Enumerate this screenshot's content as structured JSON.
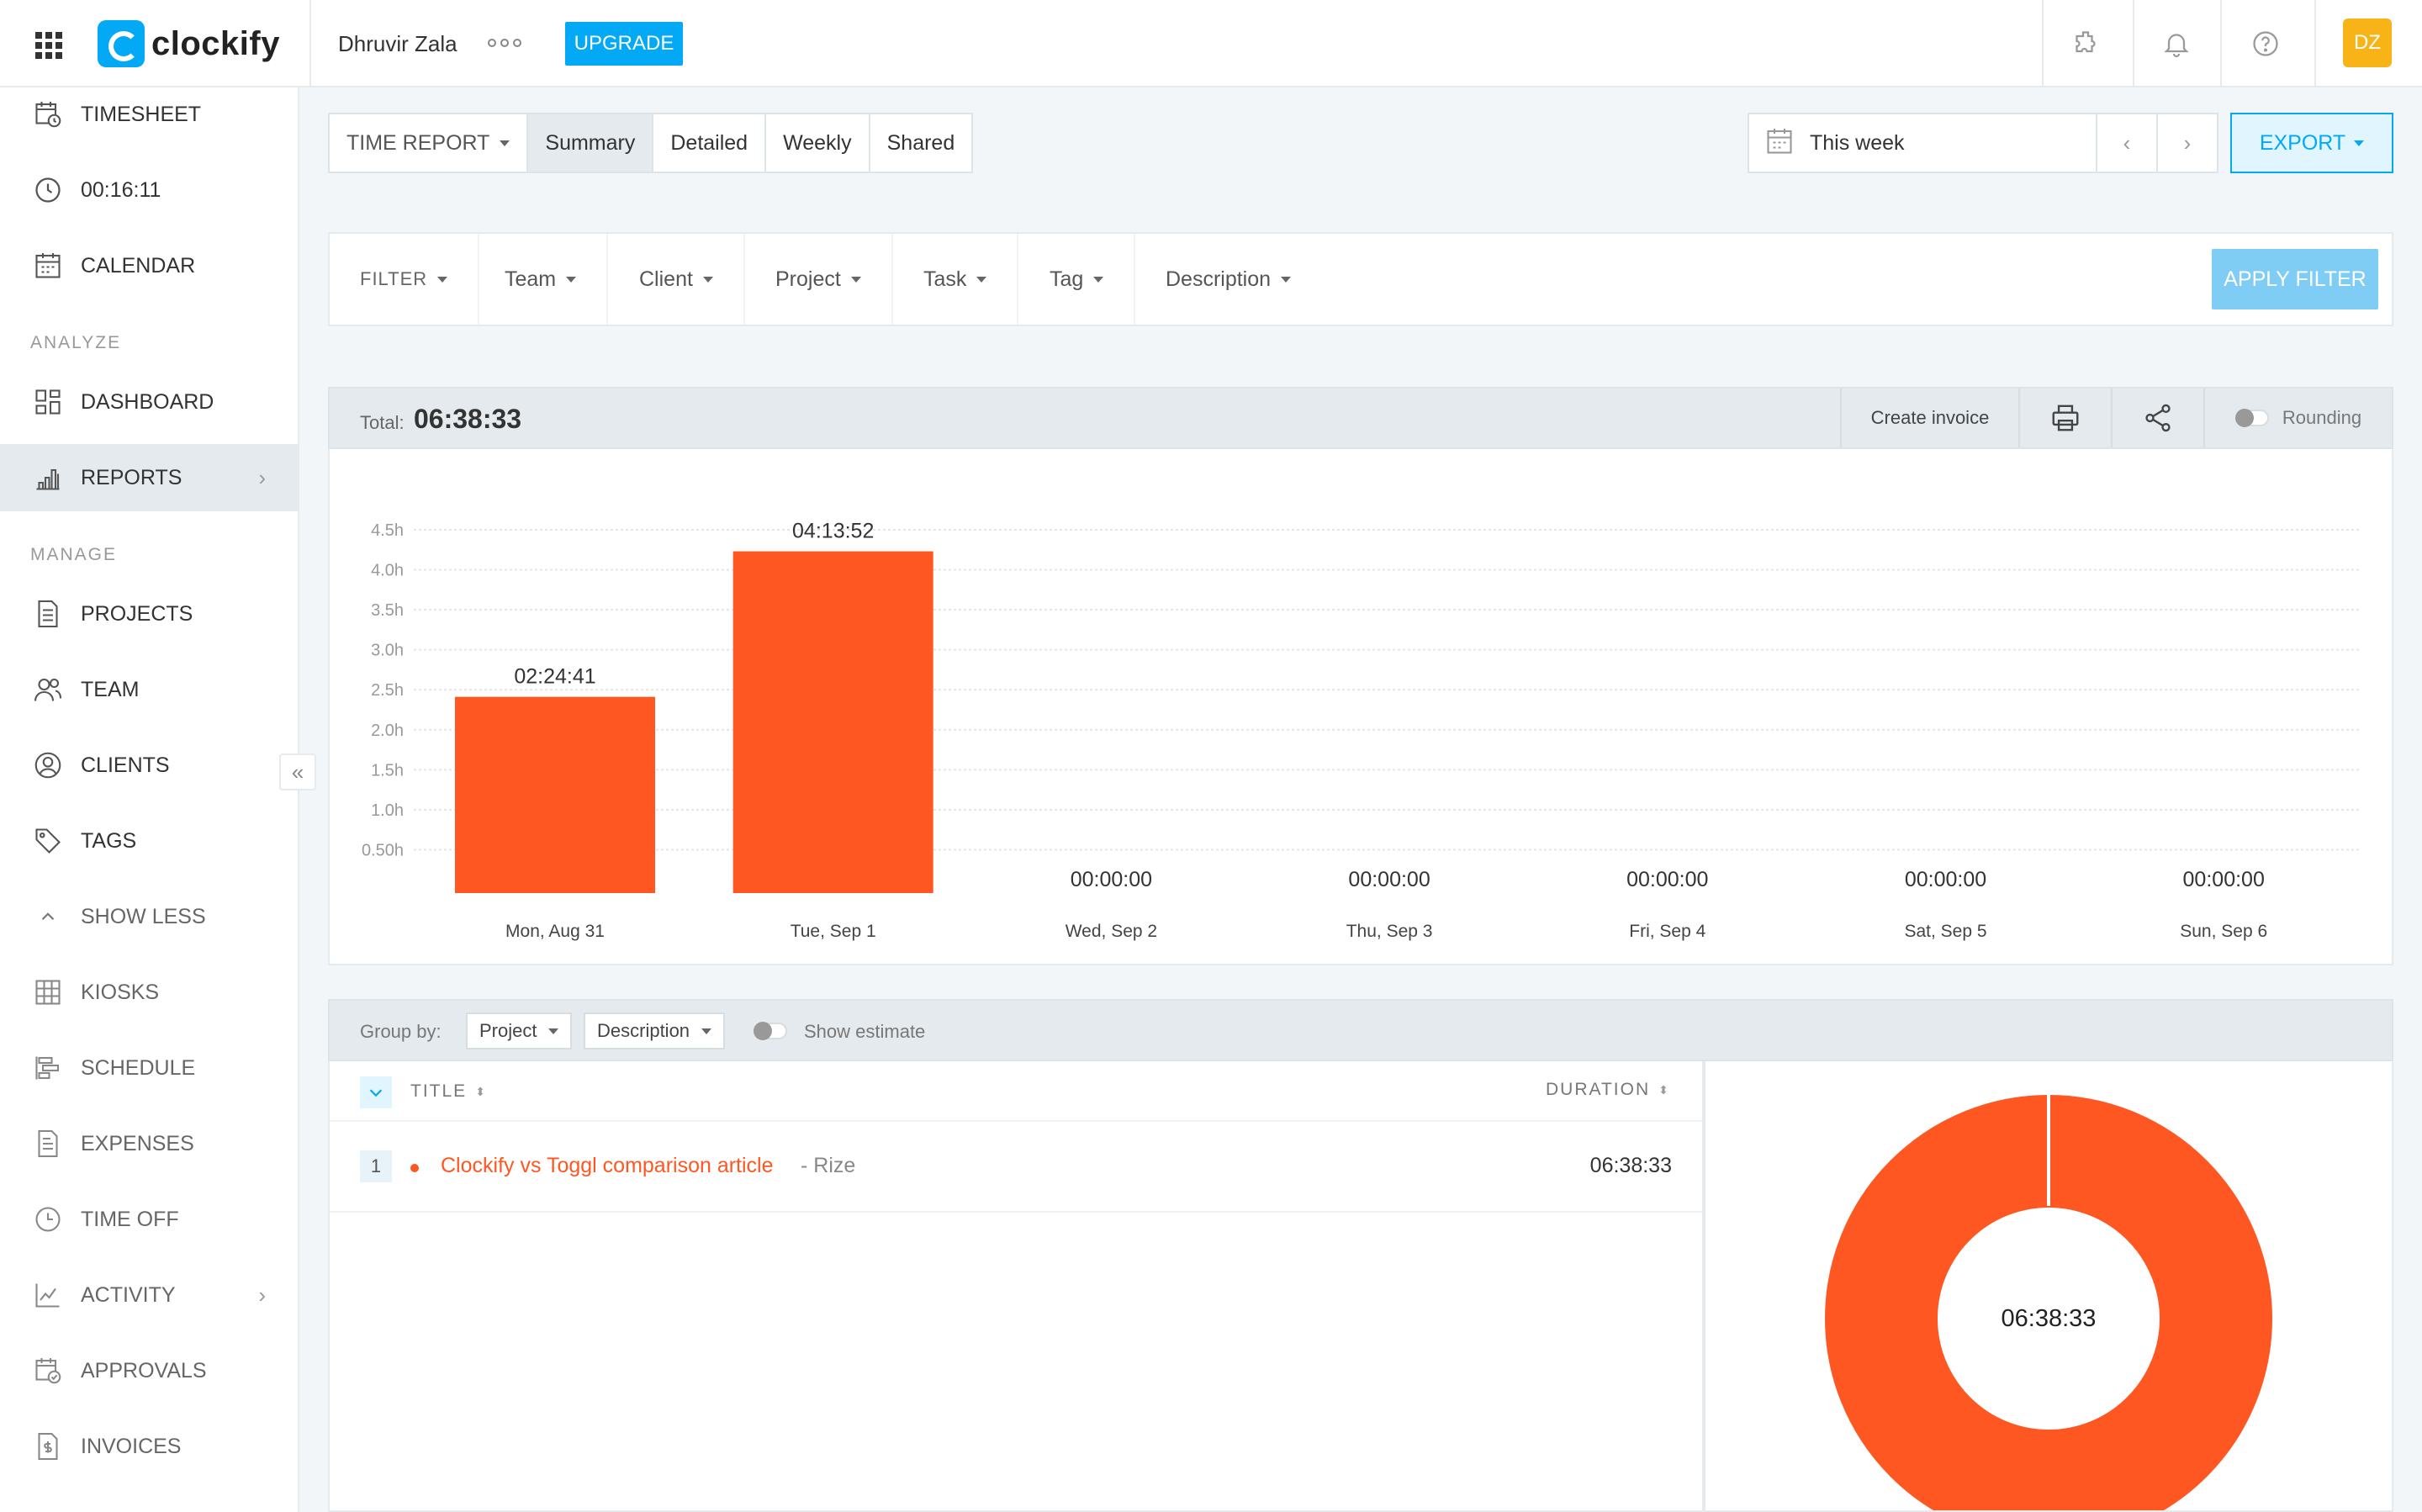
{
  "app": {
    "name": "clockify",
    "workspace": "Dhruvir Zala",
    "upgrade_label": "UPGRADE",
    "avatar_initials": "DZ"
  },
  "colors": {
    "accent": "#03a9f4",
    "bar": "#ff5722",
    "avatar": "#f8b417"
  },
  "icons": {
    "top": [
      "apps-grid-icon",
      "puzzle-icon",
      "bell-icon",
      "help-icon"
    ]
  },
  "sidebar": {
    "items_top": [
      {
        "label": "TIMESHEET",
        "icon": "timesheet-icon"
      },
      {
        "label": "00:16:11",
        "icon": "clock-icon"
      },
      {
        "label": "CALENDAR",
        "icon": "calendar-icon"
      }
    ],
    "analyze_label": "ANALYZE",
    "analyze_items": [
      {
        "label": "DASHBOARD",
        "icon": "dashboard-icon"
      },
      {
        "label": "REPORTS",
        "icon": "reports-icon"
      }
    ],
    "manage_label": "MANAGE",
    "manage_items": [
      {
        "label": "PROJECTS",
        "icon": "projects-icon"
      },
      {
        "label": "TEAM",
        "icon": "team-icon"
      },
      {
        "label": "CLIENTS",
        "icon": "clients-icon"
      },
      {
        "label": "TAGS",
        "icon": "tag-icon"
      },
      {
        "label": "SHOW LESS",
        "icon": "chevron-up-icon"
      },
      {
        "label": "KIOSKS",
        "icon": "kiosk-icon"
      },
      {
        "label": "SCHEDULE",
        "icon": "schedule-icon"
      },
      {
        "label": "EXPENSES",
        "icon": "expenses-icon"
      },
      {
        "label": "TIME OFF",
        "icon": "time-off-icon"
      },
      {
        "label": "ACTIVITY",
        "icon": "activity-icon"
      },
      {
        "label": "APPROVALS",
        "icon": "approvals-icon"
      },
      {
        "label": "INVOICES",
        "icon": "invoices-icon"
      }
    ]
  },
  "report_tabs": {
    "dropdown": "TIME REPORT",
    "tabs": [
      "Summary",
      "Detailed",
      "Weekly",
      "Shared"
    ],
    "selected": "Summary"
  },
  "date_range": {
    "label": "This week"
  },
  "export_label": "EXPORT",
  "filters": {
    "items": [
      "FILTER",
      "Team",
      "Client",
      "Project",
      "Task",
      "Tag",
      "Description"
    ],
    "apply_label": "APPLY FILTER"
  },
  "summary": {
    "total_label": "Total:",
    "total_value": "06:38:33",
    "create_invoice_label": "Create invoice",
    "rounding_label": "Rounding"
  },
  "chart_data": {
    "type": "bar",
    "categories": [
      "Mon, Aug 31",
      "Tue, Sep 1",
      "Wed, Sep 2",
      "Thu, Sep 3",
      "Fri, Sep 4",
      "Sat, Sep 5",
      "Sun, Sep 6"
    ],
    "values": [
      2.4114,
      4.2311,
      0,
      0,
      0,
      0,
      0
    ],
    "value_labels": [
      "02:24:41",
      "04:13:52",
      "00:00:00",
      "00:00:00",
      "00:00:00",
      "00:00:00",
      "00:00:00"
    ],
    "y_ticks": [
      "0.50h",
      "1.0h",
      "1.5h",
      "2.0h",
      "2.5h",
      "3.0h",
      "3.5h",
      "4.0h",
      "4.5h"
    ],
    "ylim": [
      0,
      4.5
    ],
    "grid": true,
    "title": "",
    "xlabel": "",
    "ylabel": ""
  },
  "group": {
    "label": "Group by:",
    "primary": "Project",
    "secondary": "Description",
    "estimate_label": "Show estimate"
  },
  "table": {
    "col_title": "TITLE",
    "col_duration": "DURATION",
    "rows": [
      {
        "num": "1",
        "title": "Clockify vs Toggl comparison article",
        "client": "- Rize",
        "duration": "06:38:33"
      }
    ]
  },
  "donut": {
    "center_label": "06:38:33",
    "slices": [
      {
        "value": 100
      }
    ]
  }
}
